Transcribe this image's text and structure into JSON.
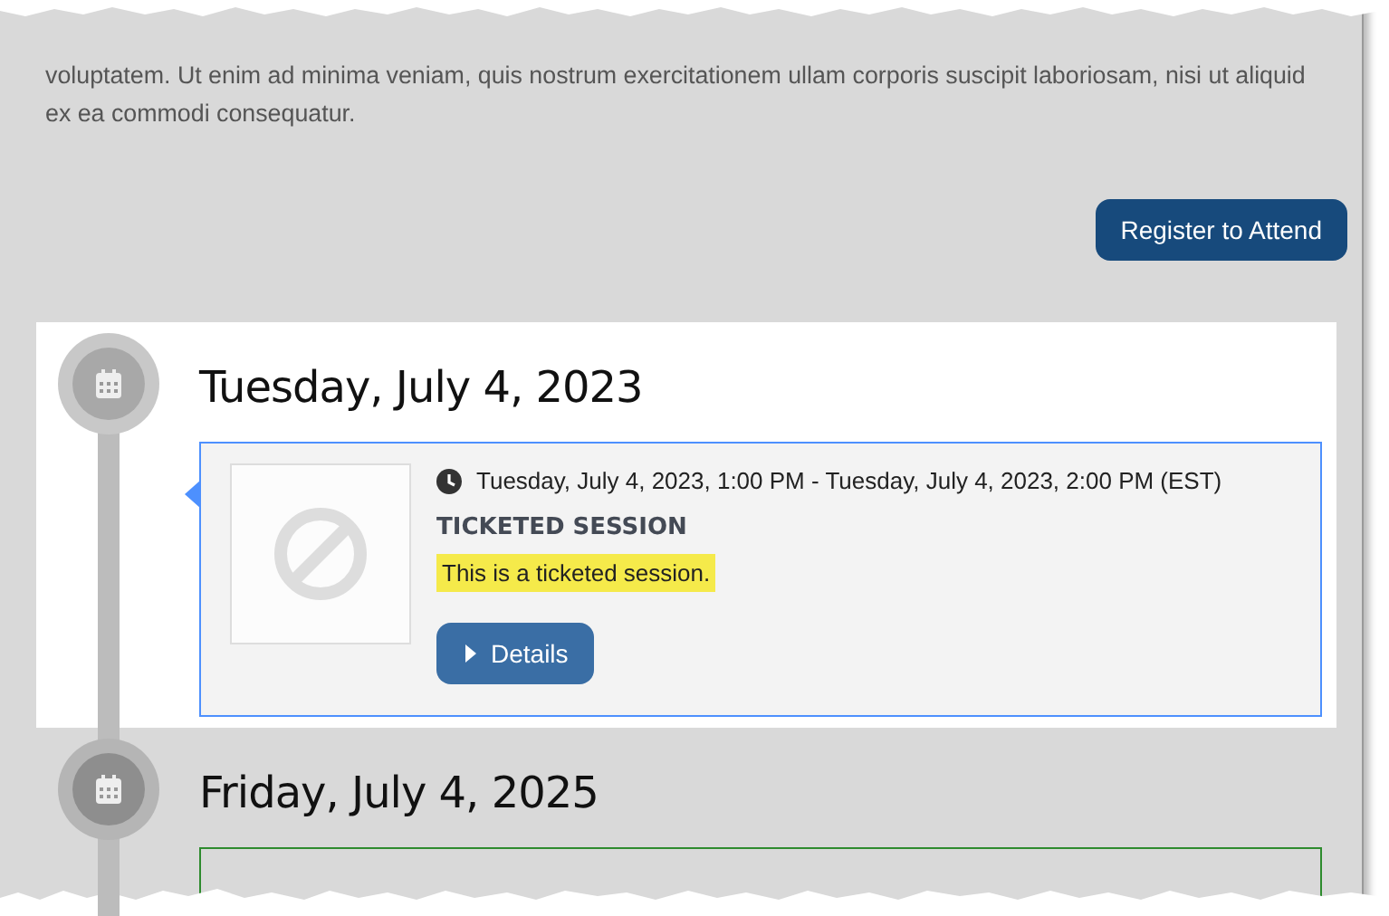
{
  "intro": {
    "text": "voluptatem. Ut enim ad minima veniam, quis nostrum exercitationem ullam corporis suscipit laboriosam, nisi ut aliquid ex ea commodi consequatur."
  },
  "register_button": {
    "label": "Register to Attend"
  },
  "days": [
    {
      "date": "Tuesday, July 4, 2023",
      "highlighted": true,
      "color": "#4d90fe",
      "session": {
        "time": "Tuesday, July 4, 2023, 1:00 PM - Tuesday, July 4, 2023, 2:00 PM (EST)",
        "title": "TICKETED SESSION",
        "description": "This is a ticketed session.",
        "button": "Details"
      }
    },
    {
      "date": "Friday, July 4, 2025",
      "highlighted": false,
      "color": "#2e8b2e"
    }
  ]
}
